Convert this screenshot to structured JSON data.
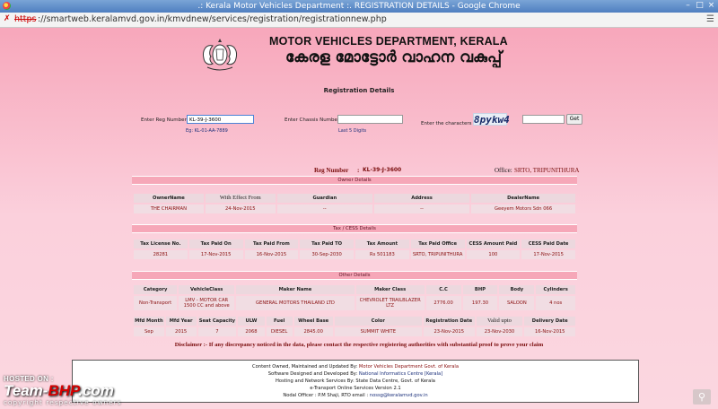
{
  "window": {
    "title": ".: Kerala Motor Vehicles Department :. REGISTRATION DETAILS - Google Chrome",
    "icon": "chrome-app-icon",
    "controls": [
      "–",
      "□",
      "×"
    ]
  },
  "address_bar": {
    "scheme": "https",
    "url_rest": "://smartweb.keralamvd.gov.in/kmvdnew/services/registration/registrationnew.php",
    "insecure_color": "#cc0000"
  },
  "header": {
    "dept_en": "MOTOR VEHICLES DEPARTMENT, KERALA",
    "dept_ml": "കേരള മോട്ടോർ വാഹന വകുപ്പ്",
    "page_title": "Registration Details"
  },
  "form": {
    "reg_label": "Enter Reg Number",
    "reg_value": "KL-39-J-3600",
    "reg_hint": "Eg: KL-01-AA-7889",
    "chassis_label": "Enter Chassis Number",
    "chassis_value": "",
    "chassis_hint": "Last 5 Digits",
    "captcha_label": "Enter the characters",
    "captcha_text": "8pykw4",
    "captcha_value": "",
    "get_button": "Get"
  },
  "result": {
    "reg_label": "Reg Number",
    "reg_sep": ":",
    "reg_value": "KL-39-J-3600",
    "office_label": "Office:",
    "office_value": "SRTO, TRIPUNITHURA"
  },
  "owner_section": {
    "title": "Owner Details",
    "headers": [
      "OwnerName",
      "With Effect From",
      "Guardian",
      "Address",
      "DealerName"
    ],
    "row": [
      "THE CHAIRMAN",
      "24-Nov-2015",
      "--",
      "--",
      "Geeyem Motors Sdn 066"
    ]
  },
  "tax_section": {
    "title": "Tax / CESS Details",
    "headers": [
      "Tax License No.",
      "Tax Paid On",
      "Tax Paid From",
      "Tax Paid TO",
      "Tax Amount",
      "Tax Paid Office",
      "CESS Amount Paid",
      "CESS Paid Date"
    ],
    "row": [
      "28281",
      "17-Nov-2015",
      "16-Nov-2015",
      "30-Sep-2030",
      "Rs 501183",
      "SRTO, TRIPUNITHURA",
      "100",
      "17-Nov-2015"
    ]
  },
  "other_section": {
    "title": "Other Details",
    "headers1": [
      "Category",
      "VehicleClass",
      "Maker Name",
      "Maker Class",
      "C.C",
      "BHP",
      "Body",
      "Cylinders"
    ],
    "row1": [
      "Non-Transport",
      "LMV - MOTOR CAR 1500 CC and above",
      "GENERAL MOTORS THAILAND LTD",
      "CHEVROLET TRAILBLAZER LTZ",
      "2776.00",
      "197.30",
      "SALOON",
      "4 nos"
    ],
    "headers2": [
      "Mfd Month",
      "Mfd Year",
      "Seat Capacity",
      "ULW",
      "Fuel",
      "Wheel Base",
      "Color",
      "Registration Date",
      "Valid upto",
      "Delivery Date"
    ],
    "row2": [
      "Sep",
      "2015",
      "7",
      "2068",
      "DIESEL",
      "2845.00",
      "SUMMIT WHITE",
      "23-Nov-2015",
      "23-Nov-2030",
      "16-Nov-2015"
    ]
  },
  "disclaimer": "Disclaimer :- If any discrepancy noticed in the data, please contact the respective registering authorities with substantial proof to prove your claim",
  "footer": {
    "line1_a": "Content Owned, Maintained and Updated By:",
    "line1_b": "Motor Vehicles Department Govt. of Kerala",
    "line2_a": "Software Designed and Developed By:",
    "line2_b": "National Informatics Centre [Kerala]",
    "line3": "Hosting and Network Services By: State Data Centre, Govt. of Kerala",
    "line4": "e-Transport Online Services Version 2.1",
    "line5_a": "Nodal Officer : P.M Shaji, RTO  email :",
    "line5_b": "nossg@keralamvd.gov.in"
  },
  "watermark": {
    "hosted": "HOSTED ON :",
    "brand_a": "Team-",
    "brand_b": "BHP",
    "brand_c": ".com",
    "copyright": "copyright respective owners"
  },
  "colors": {
    "page_bg": "#f6b8c6",
    "accent_maroon": "#7a0d0d",
    "section_bar": "#f6a7b8",
    "link_blue": "#1a2f7a"
  }
}
